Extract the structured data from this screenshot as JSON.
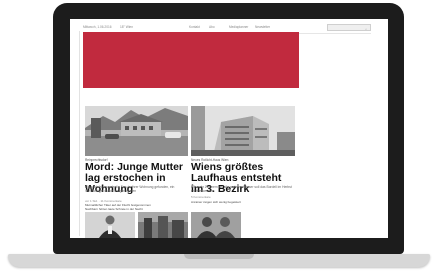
{
  "site": {
    "date": "Mittwoch, 1.06.2016",
    "weather": "18° Wien",
    "nav": [
      "Kontakt",
      "Abo",
      "Mediaplanner",
      "Newsletter"
    ],
    "search_placeholder": ""
  },
  "articles": [
    {
      "kicker": "Reinprechtsdorf",
      "headline": "Mord: Junge Mutter lag erstochen in Wohnung",
      "teaser": "Mittwoch früh wurde die Frau in ihrer Wohnung gefunden, ein Verdächtiger wurde festgenommen",
      "meta": "vor 1 Std. · 11 Kommentare",
      "links": [
        "Mutmaßlicher Täter auf der Flucht festgenommen",
        "Nachbarn hörten laute Schreie in der Nacht"
      ]
    },
    {
      "kicker": "Neues Rotlicht-Haus Wien",
      "headline": "Wiens größtes Laufhaus entsteht im 3. Bezirk",
      "teaser": "Mit mehr Zimmern als alle anderen Häuser soll das Bordell im Herbst eröffnet werden",
      "meta": "5 Kommentare",
      "links": [
        "Anrainer zeigen sich wenig begeistert"
      ]
    }
  ],
  "colors": {
    "ad": "#c12a3e"
  }
}
